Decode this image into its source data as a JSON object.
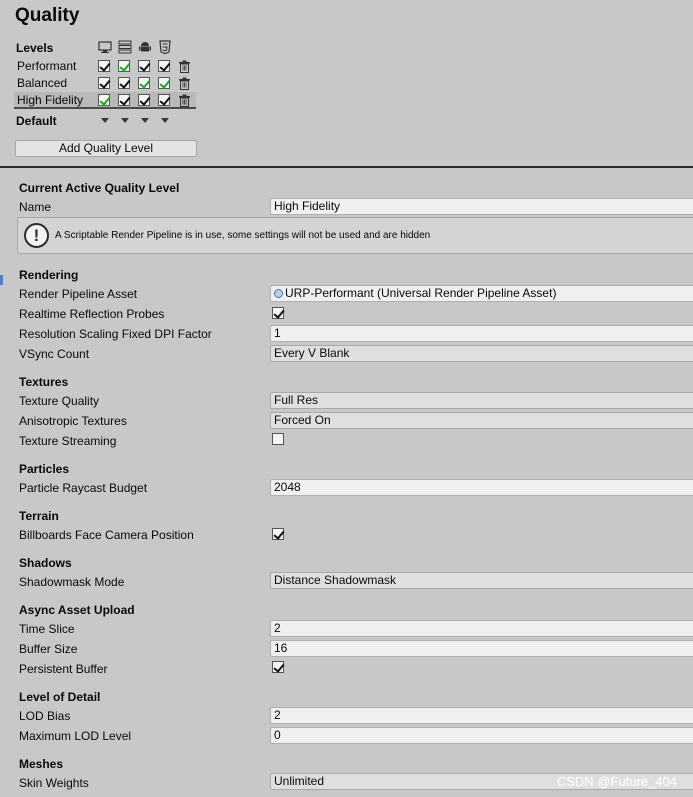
{
  "title": "Quality",
  "levels": {
    "header": "Levels",
    "platform_icons": [
      "desktop-icon",
      "server-icon",
      "android-icon",
      "html5-icon"
    ],
    "rows": [
      {
        "name": "Performant",
        "checks": [
          true,
          true,
          true,
          true
        ],
        "selected": false
      },
      {
        "name": "Balanced",
        "checks": [
          true,
          true,
          true,
          true
        ],
        "selected": false
      },
      {
        "name": "High Fidelity",
        "checks": [
          true,
          true,
          true,
          true
        ],
        "selected": true
      }
    ],
    "default_label": "Default",
    "add_button": "Add Quality Level"
  },
  "active": {
    "section": "Current Active Quality Level",
    "name_label": "Name",
    "name_value": "High Fidelity",
    "help_text": "A Scriptable Render Pipeline is in use, some settings will not be used and are hidden"
  },
  "rendering": {
    "section": "Rendering",
    "pipeline_label": "Render Pipeline Asset",
    "pipeline_value": "URP-Performant (Universal Render Pipeline Asset)",
    "reflection_label": "Realtime Reflection Probes",
    "reflection_checked": true,
    "dpi_label": "Resolution Scaling Fixed DPI Factor",
    "dpi_value": "1",
    "vsync_label": "VSync Count",
    "vsync_value": "Every V Blank"
  },
  "textures": {
    "section": "Textures",
    "quality_label": "Texture Quality",
    "quality_value": "Full Res",
    "aniso_label": "Anisotropic Textures",
    "aniso_value": "Forced On",
    "streaming_label": "Texture Streaming",
    "streaming_checked": false
  },
  "particles": {
    "section": "Particles",
    "raycast_label": "Particle Raycast Budget",
    "raycast_value": "2048"
  },
  "terrain": {
    "section": "Terrain",
    "billboards_label": "Billboards Face Camera Position",
    "billboards_checked": true
  },
  "shadows": {
    "section": "Shadows",
    "mask_label": "Shadowmask Mode",
    "mask_value": "Distance Shadowmask"
  },
  "async": {
    "section": "Async Asset Upload",
    "slice_label": "Time Slice",
    "slice_value": "2",
    "buffer_label": "Buffer Size",
    "buffer_value": "16",
    "persistent_label": "Persistent Buffer",
    "persistent_checked": true
  },
  "lod": {
    "section": "Level of Detail",
    "bias_label": "LOD Bias",
    "bias_value": "2",
    "max_label": "Maximum LOD Level",
    "max_value": "0"
  },
  "meshes": {
    "section": "Meshes",
    "skin_label": "Skin Weights",
    "skin_value": "Unlimited"
  },
  "watermark": "CSDN @Future_404",
  "colors": {
    "accent_check": "#18a818",
    "background": "#c8c8c8",
    "separator": "#2b2b2b"
  }
}
